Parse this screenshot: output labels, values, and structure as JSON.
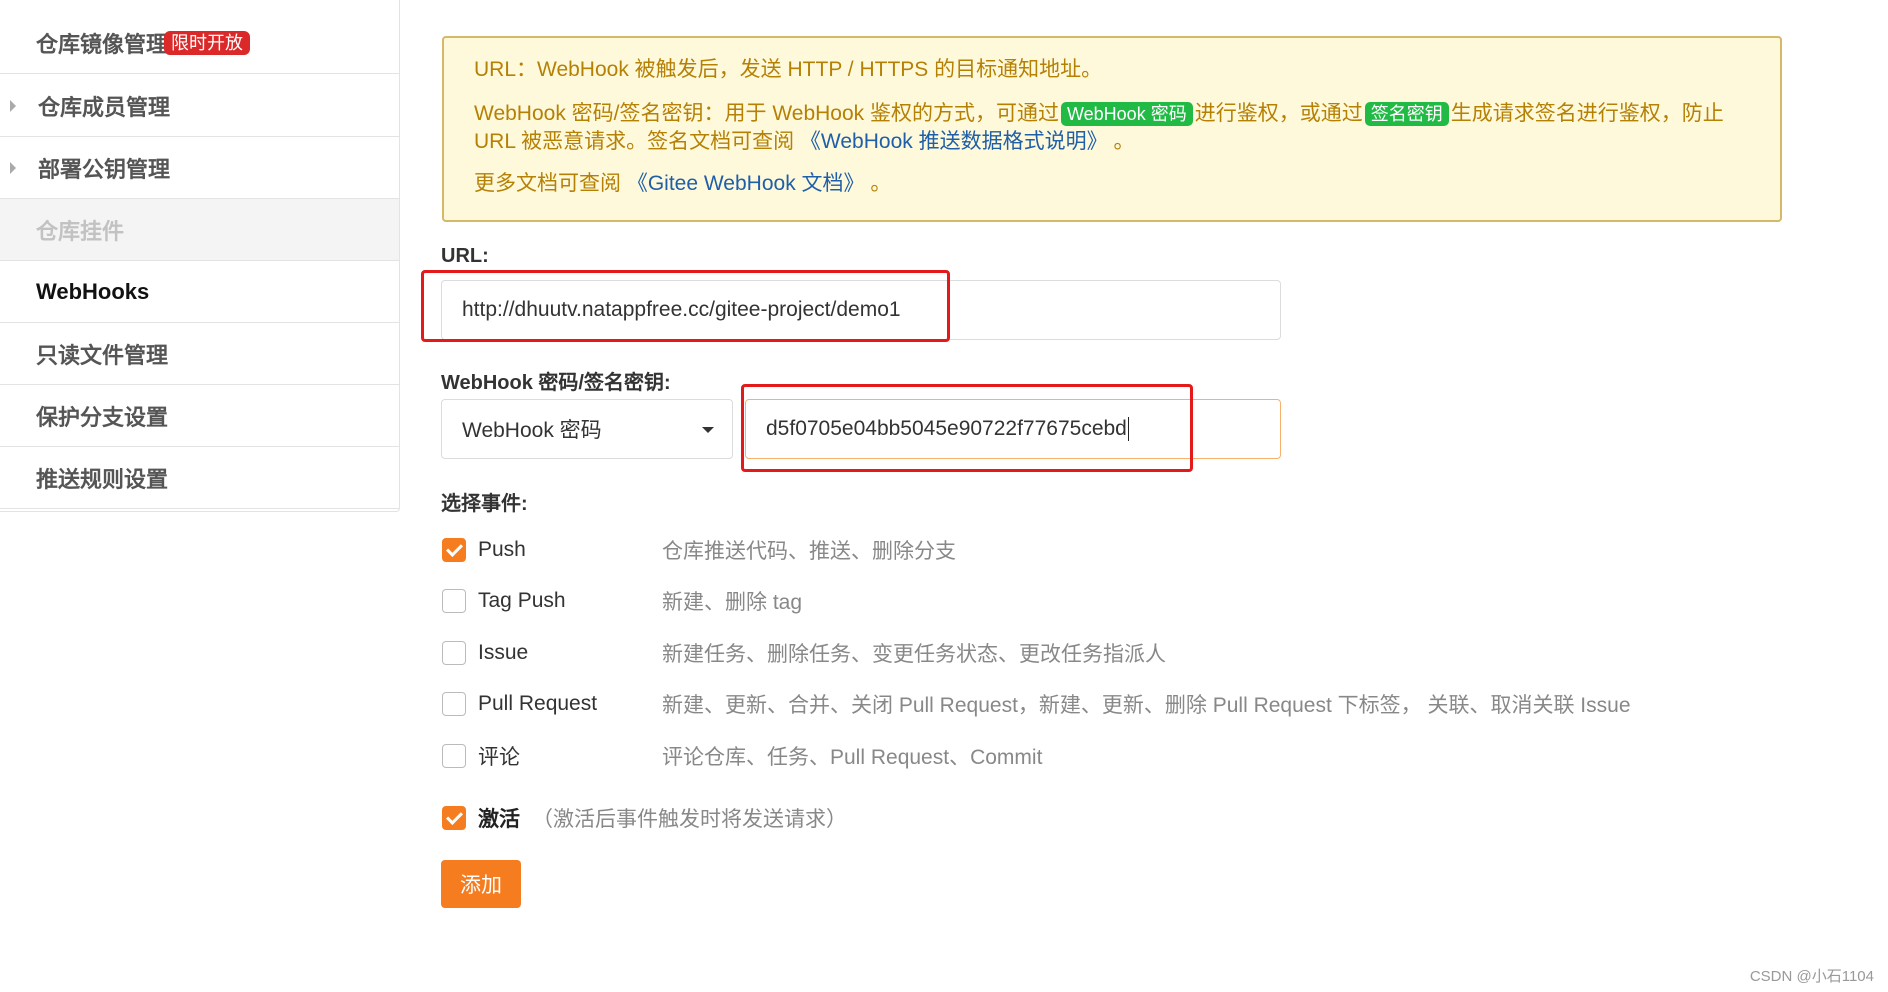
{
  "sidebar": {
    "items": [
      {
        "label": "仓库镜像管理",
        "badge": "限时开放"
      },
      {
        "label": "仓库成员管理"
      },
      {
        "label": "部署公钥管理"
      },
      {
        "label": "仓库挂件"
      },
      {
        "label": "WebHooks"
      },
      {
        "label": "只读文件管理"
      },
      {
        "label": "保护分支设置"
      },
      {
        "label": "推送规则设置"
      }
    ]
  },
  "notice": {
    "line1": "URL：WebHook 被触发后，发送 HTTP / HTTPS 的目标通知地址。",
    "line2_a": "WebHook 密码/签名密钥：用于 WebHook 鉴权的方式，可通过",
    "tag1": "WebHook 密码",
    "line2_b": "进行鉴权，或通过",
    "tag2": "签名密钥",
    "line2_c": "生成请求签名进行鉴权，防止 URL 被恶意请求。签名文档可查阅",
    "link1": "《WebHook 推送数据格式说明》",
    "line2_d": "。",
    "line3_a": "更多文档可查阅",
    "link2": "《Gitee WebHook 文档》",
    "line3_b": "。"
  },
  "form": {
    "url_label": "URL:",
    "url_value": "http://dhuutv.natappfree.cc/gitee-project/demo1",
    "secret_label": "WebHook 密码/签名密钥:",
    "auth_type_selected": "WebHook 密码",
    "secret_value": "d5f0705e04bb5045e90722f77675cebd",
    "events_label": "选择事件:",
    "events": [
      {
        "name": "Push",
        "desc": "仓库推送代码、推送、删除分支",
        "checked": true
      },
      {
        "name": "Tag Push",
        "desc": "新建、删除 tag",
        "checked": false
      },
      {
        "name": "Issue",
        "desc": "新建任务、删除任务、变更任务状态、更改任务指派人",
        "checked": false
      },
      {
        "name": "Pull Request",
        "desc": "新建、更新、合并、关闭 Pull Request，新建、更新、删除 Pull Request 下标签， 关联、取消关联 Issue",
        "checked": false
      },
      {
        "name": "评论",
        "desc": "评论仓库、任务、Pull Request、Commit",
        "checked": false
      }
    ],
    "activate_label": "激活",
    "activate_note": "（激活后事件触发时将发送请求）",
    "activate_checked": true,
    "submit_label": "添加"
  },
  "watermark": "CSDN @小石1104",
  "colors": {
    "accent": "#f57d1f",
    "highlight_box": "#e41a1a",
    "notice_bg": "#fff9dc",
    "notice_text": "#b58105",
    "tag_green": "#21ba45",
    "link": "#1e5fa8"
  }
}
